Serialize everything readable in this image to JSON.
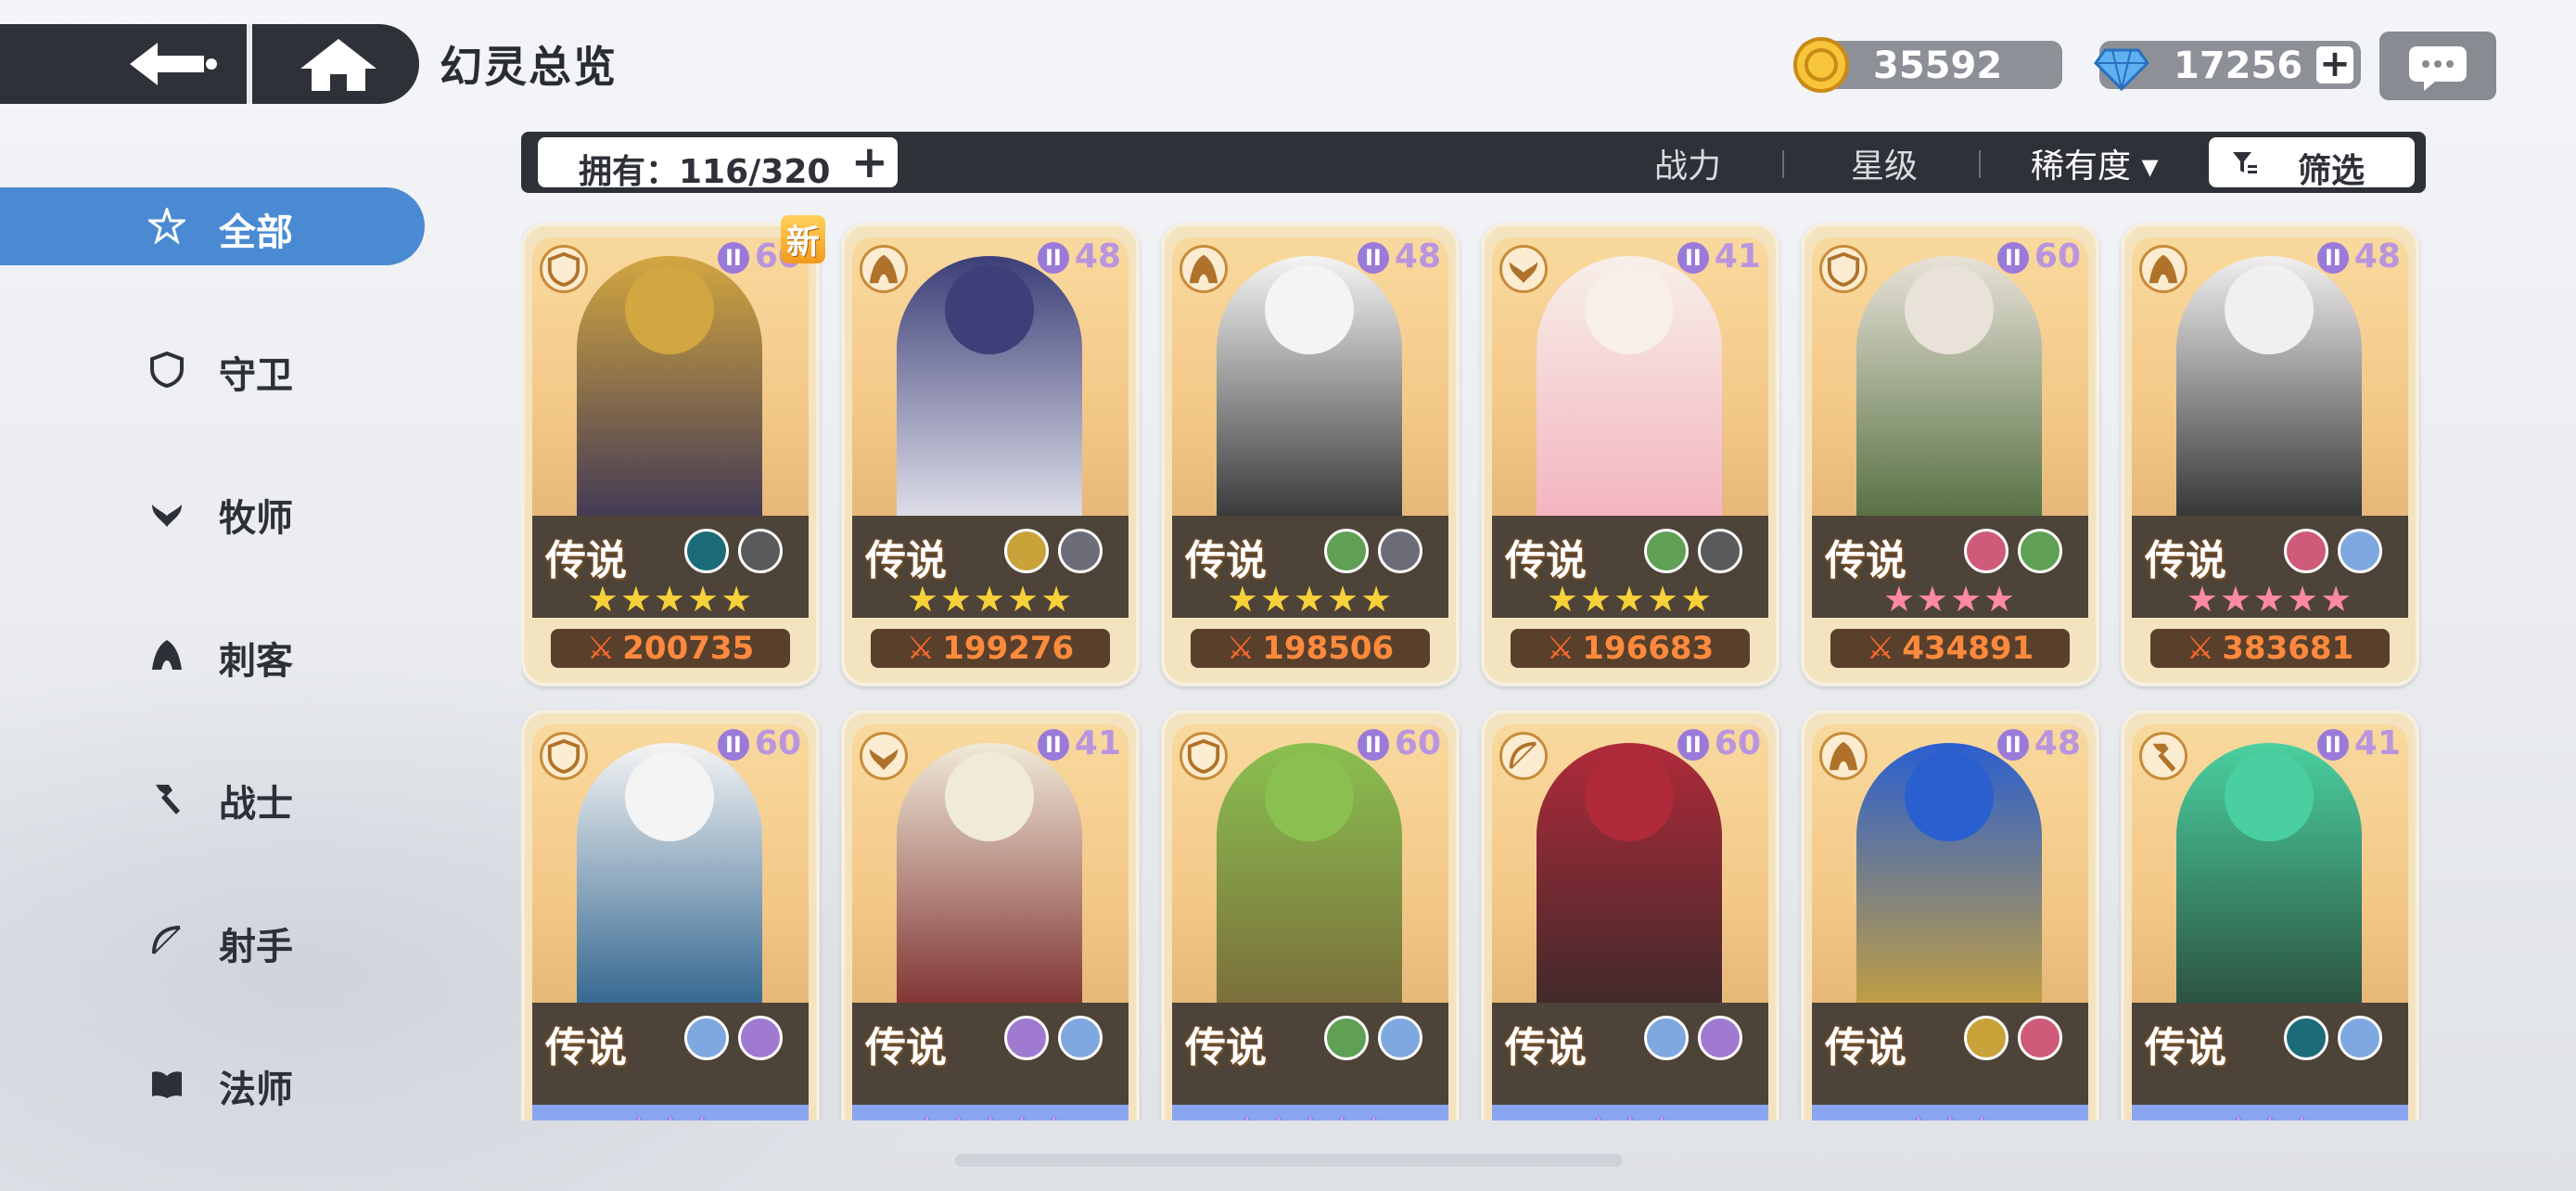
{
  "header": {
    "title": "幻灵总览",
    "gold": "35592",
    "gems": "17256",
    "gem_plus": "+"
  },
  "sidebar": {
    "items": [
      {
        "label": "全部",
        "icon": "star-swirl-icon",
        "active": true
      },
      {
        "label": "守卫",
        "icon": "shield-icon"
      },
      {
        "label": "牧师",
        "icon": "wing-heal-icon"
      },
      {
        "label": "刺客",
        "icon": "hood-icon"
      },
      {
        "label": "战士",
        "icon": "hammer-icon"
      },
      {
        "label": "射手",
        "icon": "bow-icon"
      },
      {
        "label": "法师",
        "icon": "book-icon"
      }
    ]
  },
  "toolbar": {
    "owned": "拥有：116/320",
    "add": "+",
    "sort_power": "战力",
    "sort_star": "星级",
    "sort_rarity": "稀有度 ▾",
    "filter": "筛选"
  },
  "cards": [
    {
      "level": "60",
      "rarity": "传说",
      "stars": "★★★★★",
      "power": "200735",
      "class": "shield-icon",
      "new": "新",
      "elements": [
        "#1c6b78",
        "#5a5a5a"
      ],
      "star_color": "#f7d13a",
      "art": [
        "#3a3356",
        "#d2a640"
      ]
    },
    {
      "level": "48",
      "rarity": "传说",
      "stars": "★★★★★",
      "power": "199276",
      "class": "hood-icon",
      "elements": [
        "#c9a23a",
        "#6d6d7a"
      ],
      "star_color": "#f7d13a",
      "art": [
        "#e8e8ef",
        "#3c3f78"
      ]
    },
    {
      "level": "48",
      "rarity": "传说",
      "stars": "★★★★★",
      "power": "198506",
      "class": "hood-icon",
      "elements": [
        "#5fa055",
        "#6d6d7a"
      ],
      "star_color": "#f7d13a",
      "art": [
        "#2e2e30",
        "#f4f4f4"
      ]
    },
    {
      "level": "41",
      "rarity": "传说",
      "stars": "★★★★★",
      "power": "196683",
      "class": "wing-heal-icon",
      "elements": [
        "#5fa055",
        "#5a5a5a"
      ],
      "star_color": "#f7d13a",
      "art": [
        "#f3b1bd",
        "#f7efe8"
      ]
    },
    {
      "level": "60",
      "rarity": "传说",
      "stars": "★★★★",
      "power": "434891",
      "class": "shield-icon",
      "elements": [
        "#d05a7a",
        "#5fa055"
      ],
      "star_color": "#ff8aa0",
      "art": [
        "#4e6a3a",
        "#e8e2d8"
      ]
    },
    {
      "level": "48",
      "rarity": "传说",
      "stars": "★★★★★",
      "power": "383681",
      "class": "hood-icon",
      "elements": [
        "#d05a7a",
        "#7fa8e0"
      ],
      "star_color": "#ff8aa0",
      "art": [
        "#2a2a2a",
        "#f1efef"
      ]
    },
    {
      "level": "60",
      "rarity": "传说",
      "stars": "★★★",
      "class": "shield-icon",
      "elements": [
        "#7fa8e0",
        "#a07ad0"
      ],
      "art": [
        "#2a5f8a",
        "#f4f4f4"
      ]
    },
    {
      "level": "41",
      "rarity": "传说",
      "stars": "★★★★★",
      "class": "wing-heal-icon",
      "elements": [
        "#a07ad0",
        "#7fa8e0"
      ],
      "art": [
        "#7a2a2a",
        "#f0ead8"
      ]
    },
    {
      "level": "60",
      "rarity": "传说",
      "stars": "★★★★★",
      "class": "shield-icon",
      "elements": [
        "#5fa055",
        "#7fa8e0"
      ],
      "art": [
        "#7a6a3a",
        "#8ac050"
      ]
    },
    {
      "level": "60",
      "rarity": "传说",
      "stars": "★★★",
      "class": "bow-icon",
      "elements": [
        "#7fa8e0",
        "#a07ad0"
      ],
      "art": [
        "#3a2a2a",
        "#b02a3a"
      ]
    },
    {
      "level": "48",
      "rarity": "传说",
      "stars": "★★★",
      "class": "hood-icon",
      "elements": [
        "#c9a23a",
        "#d05a7a"
      ],
      "art": [
        "#c9a23a",
        "#2a5fd0"
      ]
    },
    {
      "level": "41",
      "rarity": "传说",
      "stars": "★★★",
      "class": "hammer-icon",
      "elements": [
        "#1c6b78",
        "#7fa8e0"
      ],
      "art": [
        "#2a4a3a",
        "#4ad0a0"
      ]
    }
  ]
}
